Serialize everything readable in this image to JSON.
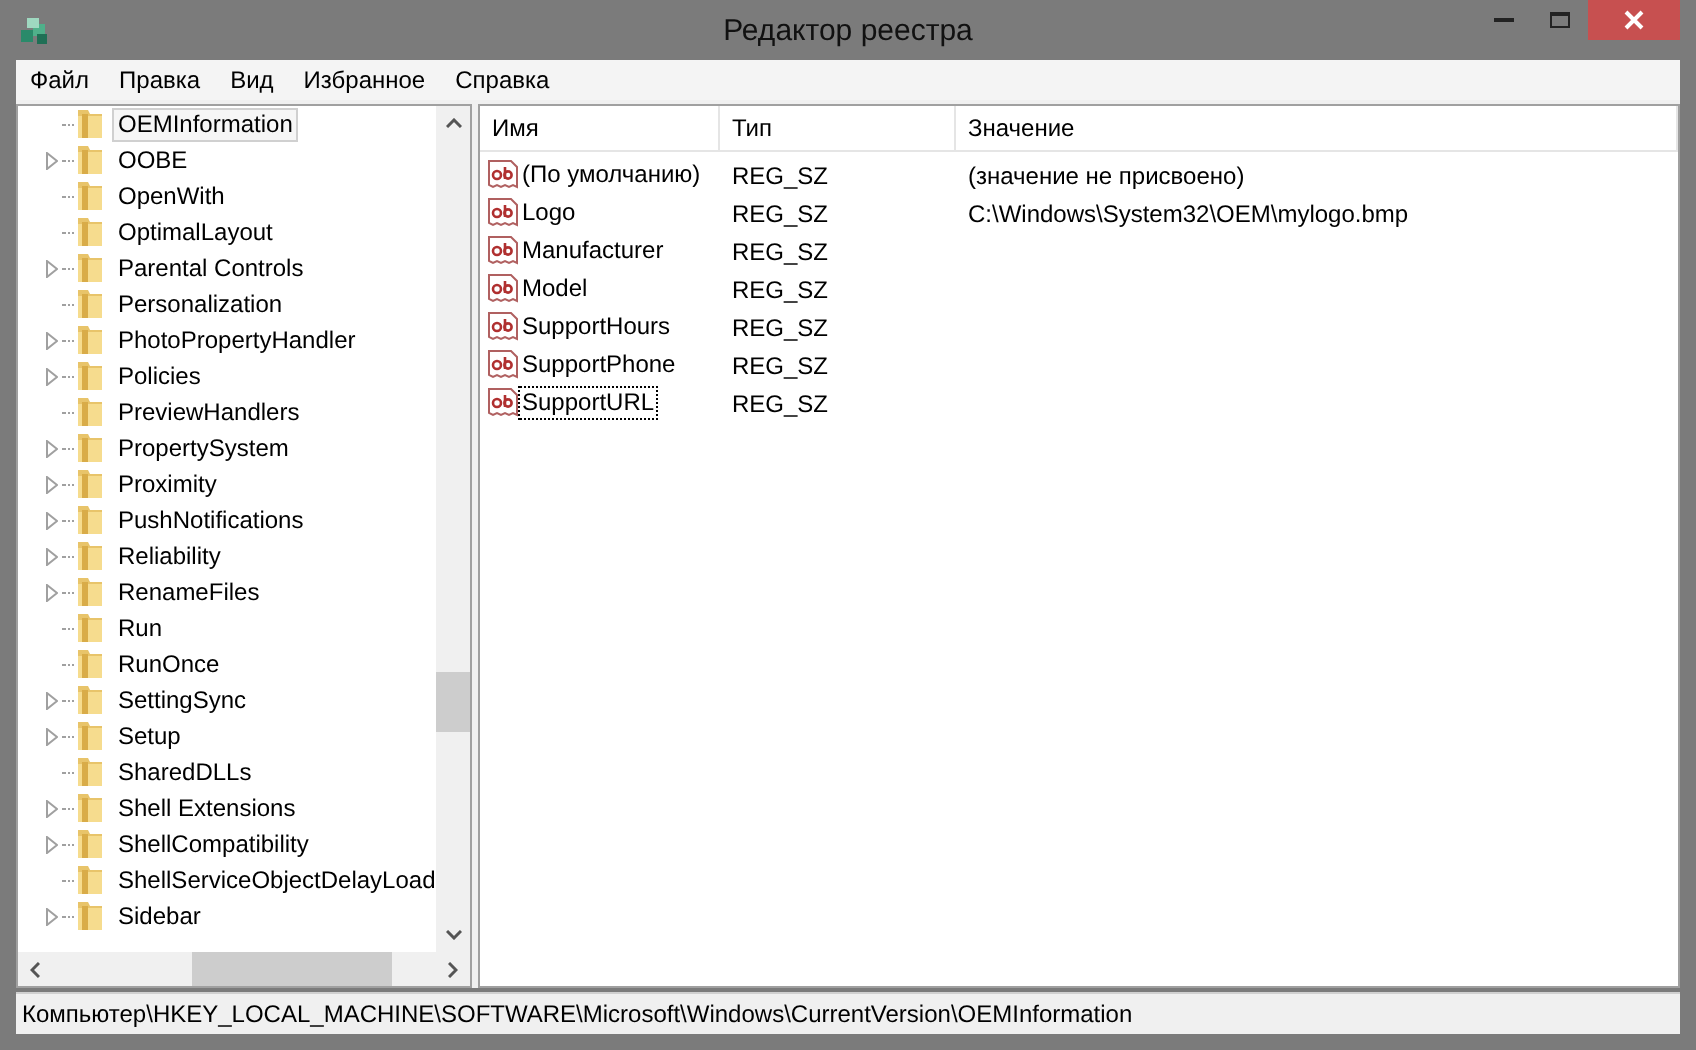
{
  "window": {
    "title": "Редактор реестра"
  },
  "menu": [
    "Файл",
    "Правка",
    "Вид",
    "Избранное",
    "Справка"
  ],
  "tree": {
    "items": [
      {
        "label": "OEMInformation",
        "expandable": false,
        "selected": true
      },
      {
        "label": "OOBE",
        "expandable": true,
        "selected": false
      },
      {
        "label": "OpenWith",
        "expandable": false,
        "selected": false
      },
      {
        "label": "OptimalLayout",
        "expandable": false,
        "selected": false
      },
      {
        "label": "Parental Controls",
        "expandable": true,
        "selected": false
      },
      {
        "label": "Personalization",
        "expandable": false,
        "selected": false
      },
      {
        "label": "PhotoPropertyHandler",
        "expandable": true,
        "selected": false
      },
      {
        "label": "Policies",
        "expandable": true,
        "selected": false
      },
      {
        "label": "PreviewHandlers",
        "expandable": false,
        "selected": false
      },
      {
        "label": "PropertySystem",
        "expandable": true,
        "selected": false
      },
      {
        "label": "Proximity",
        "expandable": true,
        "selected": false
      },
      {
        "label": "PushNotifications",
        "expandable": true,
        "selected": false
      },
      {
        "label": "Reliability",
        "expandable": true,
        "selected": false
      },
      {
        "label": "RenameFiles",
        "expandable": true,
        "selected": false
      },
      {
        "label": "Run",
        "expandable": false,
        "selected": false
      },
      {
        "label": "RunOnce",
        "expandable": false,
        "selected": false
      },
      {
        "label": "SettingSync",
        "expandable": true,
        "selected": false
      },
      {
        "label": "Setup",
        "expandable": true,
        "selected": false
      },
      {
        "label": "SharedDLLs",
        "expandable": false,
        "selected": false
      },
      {
        "label": "Shell Extensions",
        "expandable": true,
        "selected": false
      },
      {
        "label": "ShellCompatibility",
        "expandable": true,
        "selected": false
      },
      {
        "label": "ShellServiceObjectDelayLoad",
        "expandable": false,
        "selected": false
      },
      {
        "label": "Sidebar",
        "expandable": true,
        "selected": false
      }
    ]
  },
  "values": {
    "columns": [
      "Имя",
      "Тип",
      "Значение"
    ],
    "rows": [
      {
        "name": "(По умолчанию)",
        "type": "REG_SZ",
        "data": "(значение не присвоено)",
        "focused": false
      },
      {
        "name": "Logo",
        "type": "REG_SZ",
        "data": "C:\\Windows\\System32\\OEM\\mylogo.bmp",
        "focused": false
      },
      {
        "name": "Manufacturer",
        "type": "REG_SZ",
        "focused": false
      },
      {
        "name": "Model",
        "type": "REG_SZ",
        "focused": false
      },
      {
        "name": "SupportHours",
        "type": "REG_SZ",
        "focused": false
      },
      {
        "name": "SupportPhone",
        "type": "REG_SZ",
        "focused": false
      },
      {
        "name": "SupportURL",
        "type": "REG_SZ",
        "focused": true
      }
    ]
  },
  "status_bar": "Компьютер\\HKEY_LOCAL_MACHINE\\SOFTWARE\\Microsoft\\Windows\\CurrentVersion\\OEMInformation"
}
